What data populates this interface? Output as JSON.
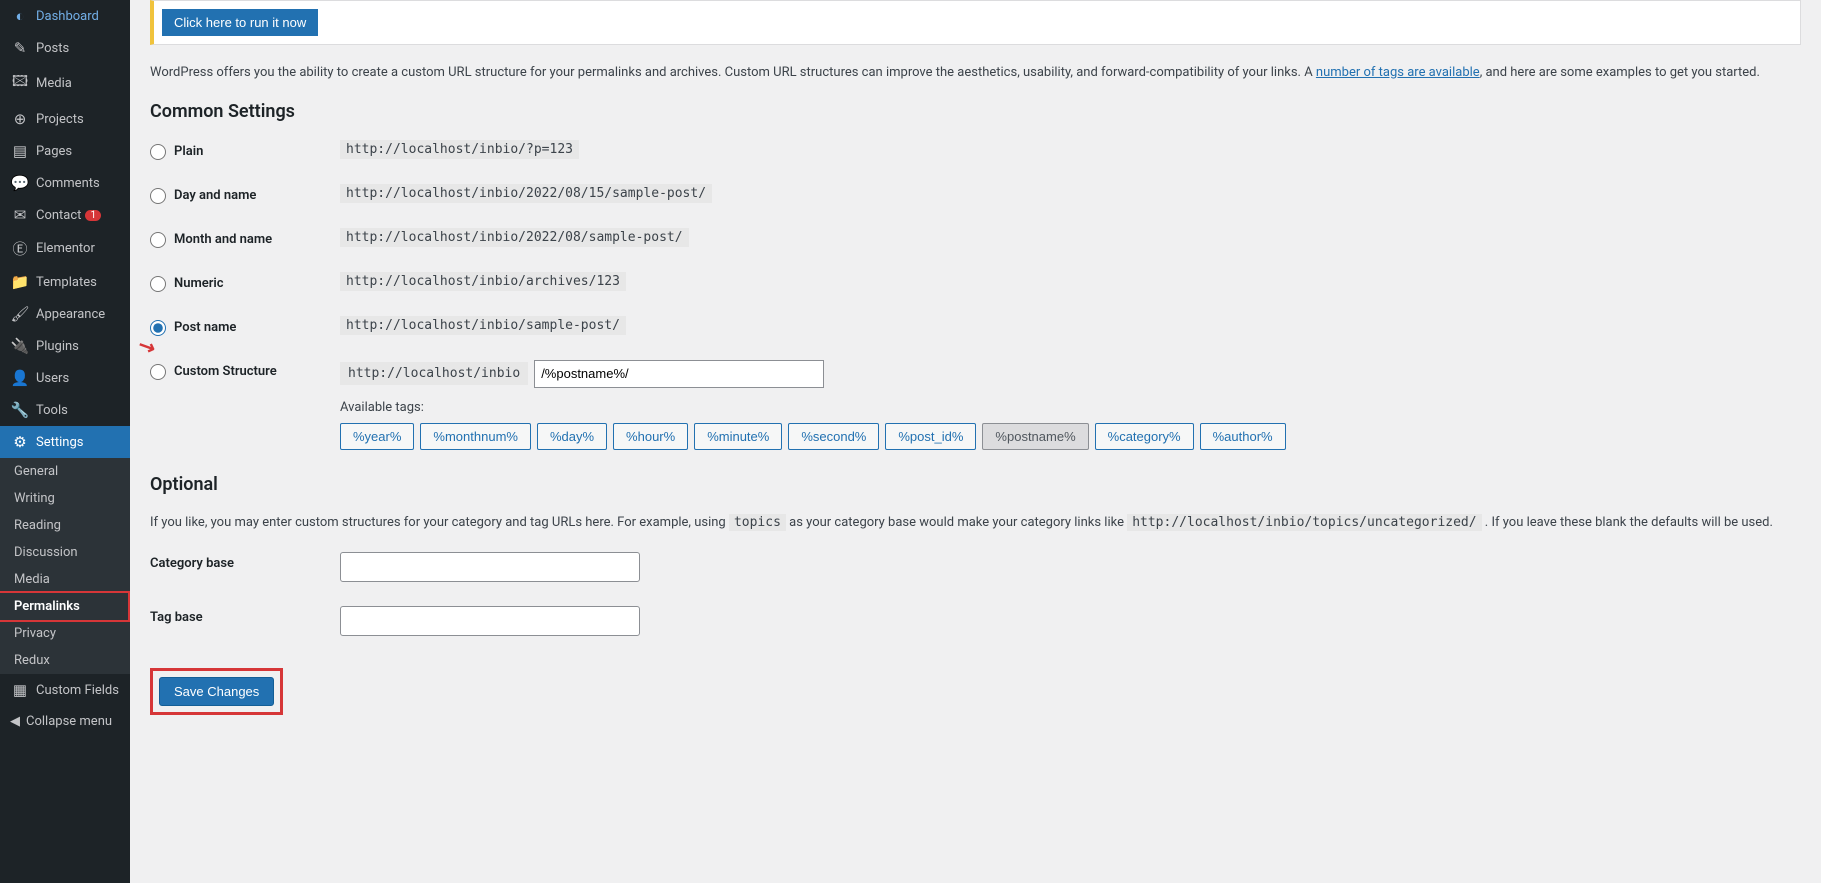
{
  "sidebar": {
    "items": [
      {
        "icon": "◐",
        "label": "Dashboard"
      },
      {
        "icon": "✎",
        "label": "Posts"
      },
      {
        "icon": "🖾",
        "label": "Media"
      },
      {
        "icon": "⊕",
        "label": "Projects"
      },
      {
        "icon": "▤",
        "label": "Pages"
      },
      {
        "icon": "💬",
        "label": "Comments"
      },
      {
        "icon": "✉",
        "label": "Contact",
        "badge": "1"
      },
      {
        "icon": "Ⓔ",
        "label": "Elementor"
      },
      {
        "icon": "📁",
        "label": "Templates"
      },
      {
        "icon": "🖌",
        "label": "Appearance"
      },
      {
        "icon": "🔌",
        "label": "Plugins"
      },
      {
        "icon": "👤",
        "label": "Users"
      },
      {
        "icon": "🔧",
        "label": "Tools"
      },
      {
        "icon": "⚙",
        "label": "Settings",
        "active": true
      },
      {
        "icon": "▦",
        "label": "Custom Fields"
      }
    ],
    "submenu": [
      {
        "label": "General"
      },
      {
        "label": "Writing"
      },
      {
        "label": "Reading"
      },
      {
        "label": "Discussion"
      },
      {
        "label": "Media"
      },
      {
        "label": "Permalinks",
        "current": true
      },
      {
        "label": "Privacy"
      },
      {
        "label": "Redux"
      }
    ],
    "collapse": "Collapse menu"
  },
  "notice": {
    "run_btn": "Click here to run it now"
  },
  "intro": {
    "before": "WordPress offers you the ability to create a custom URL structure for your permalinks and archives. Custom URL structures can improve the aesthetics, usability, and forward-compatibility of your links. A ",
    "link": "number of tags are available",
    "after": ", and here are some examples to get you started."
  },
  "common": {
    "heading": "Common Settings",
    "options": [
      {
        "label": "Plain",
        "example": "http://localhost/inbio/?p=123"
      },
      {
        "label": "Day and name",
        "example": "http://localhost/inbio/2022/08/15/sample-post/"
      },
      {
        "label": "Month and name",
        "example": "http://localhost/inbio/2022/08/sample-post/"
      },
      {
        "label": "Numeric",
        "example": "http://localhost/inbio/archives/123"
      },
      {
        "label": "Post name",
        "example": "http://localhost/inbio/sample-post/",
        "checked": true,
        "arrow": true
      },
      {
        "label": "Custom Structure"
      }
    ],
    "custom": {
      "prefix": "http://localhost/inbio",
      "value": "/%postname%/",
      "available_label": "Available tags:",
      "tags": [
        {
          "t": "%year%"
        },
        {
          "t": "%monthnum%"
        },
        {
          "t": "%day%"
        },
        {
          "t": "%hour%"
        },
        {
          "t": "%minute%"
        },
        {
          "t": "%second%"
        },
        {
          "t": "%post_id%"
        },
        {
          "t": "%postname%",
          "selected": true
        },
        {
          "t": "%category%"
        },
        {
          "t": "%author%"
        }
      ]
    }
  },
  "optional": {
    "heading": "Optional",
    "desc_before": "If you like, you may enter custom structures for your category and tag URLs here. For example, using ",
    "code1": "topics",
    "desc_mid": " as your category base would make your category links like ",
    "code2": "http://localhost/inbio/topics/uncategorized/",
    "desc_after": " . If you leave these blank the defaults will be used.",
    "category_label": "Category base",
    "tag_label": "Tag base"
  },
  "save_btn": "Save Changes"
}
